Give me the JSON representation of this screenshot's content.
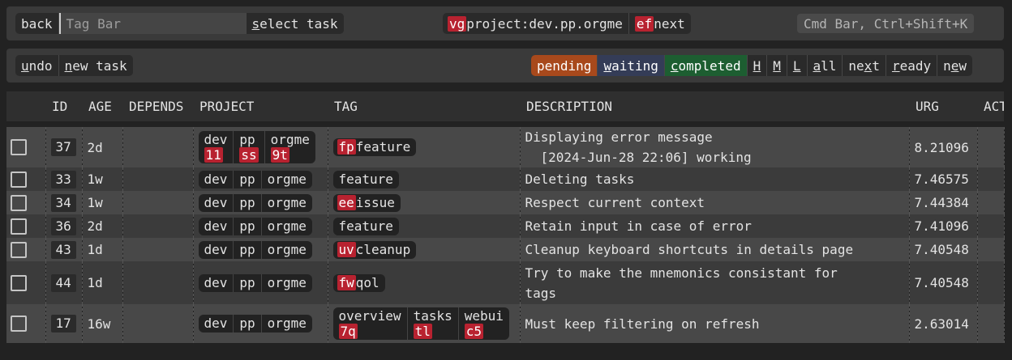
{
  "top_bar": {
    "back_label": "back",
    "tag_bar_placeholder": "Tag Bar",
    "select_task_label": "select task",
    "context": [
      {
        "key": "vg",
        "label": "project:dev.pp.orgme"
      },
      {
        "key": "ef",
        "label": "next"
      }
    ],
    "cmd_bar_placeholder": "Cmd Bar, Ctrl+Shift+K"
  },
  "actions": {
    "undo_label": "undo",
    "new_task_label": "new task"
  },
  "filters": {
    "pending": "pending",
    "waiting": "waiting",
    "completed": "completed",
    "h": "H",
    "m": "M",
    "l": "L",
    "all": "all",
    "next": "next",
    "ready": "ready",
    "new": "new"
  },
  "colors": {
    "pending": "#a8491c",
    "waiting": "#343c57",
    "completed": "#1d5e31",
    "key": "#b82230"
  },
  "table": {
    "columns": [
      "ID",
      "AGE",
      "DEPENDS",
      "PROJECT",
      "TAG",
      "DESCRIPTION",
      "URG",
      "ACTIONS"
    ],
    "rows": [
      {
        "id": "37",
        "age": "2d",
        "project": [
          {
            "label": "dev",
            "key": "11"
          },
          {
            "label": "pp",
            "key": "ss"
          },
          {
            "label": "orgme",
            "key": "9t"
          }
        ],
        "tags": [
          {
            "key": "fp",
            "label": "feature"
          }
        ],
        "description": "Displaying error message",
        "annotation": "[2024-Jun-28 22:06] working",
        "urg": "8.21096"
      },
      {
        "id": "33",
        "age": "1w",
        "project": [
          {
            "label": "dev"
          },
          {
            "label": "pp"
          },
          {
            "label": "orgme"
          }
        ],
        "tags": [
          {
            "label": "feature"
          }
        ],
        "description": "Deleting tasks",
        "urg": "7.46575"
      },
      {
        "id": "34",
        "age": "1w",
        "project": [
          {
            "label": "dev"
          },
          {
            "label": "pp"
          },
          {
            "label": "orgme"
          }
        ],
        "tags": [
          {
            "key": "ee",
            "label": "issue"
          }
        ],
        "description": "Respect current context",
        "urg": "7.44384"
      },
      {
        "id": "36",
        "age": "2d",
        "project": [
          {
            "label": "dev"
          },
          {
            "label": "pp"
          },
          {
            "label": "orgme"
          }
        ],
        "tags": [
          {
            "label": "feature"
          }
        ],
        "description": "Retain input in case of error",
        "urg": "7.41096"
      },
      {
        "id": "43",
        "age": "1d",
        "project": [
          {
            "label": "dev"
          },
          {
            "label": "pp"
          },
          {
            "label": "orgme"
          }
        ],
        "tags": [
          {
            "key": "uv",
            "label": "cleanup"
          }
        ],
        "description": "Cleanup keyboard shortcuts in details page",
        "urg": "7.40548"
      },
      {
        "id": "44",
        "age": "1d",
        "project": [
          {
            "label": "dev"
          },
          {
            "label": "pp"
          },
          {
            "label": "orgme"
          }
        ],
        "tags": [
          {
            "key": "fw",
            "label": "qol"
          }
        ],
        "description": "Try to make the mnemonics consistant for tags",
        "urg": "7.40548"
      },
      {
        "id": "17",
        "age": "16w",
        "project": [
          {
            "label": "dev"
          },
          {
            "label": "pp"
          },
          {
            "label": "orgme"
          }
        ],
        "tags": [
          {
            "label": "overview",
            "key": "7q"
          },
          {
            "label": "tasks",
            "key": "tl"
          },
          {
            "label": "webui",
            "key": "c5"
          }
        ],
        "description": "Must keep filtering on refresh",
        "urg": "2.63014"
      }
    ]
  }
}
